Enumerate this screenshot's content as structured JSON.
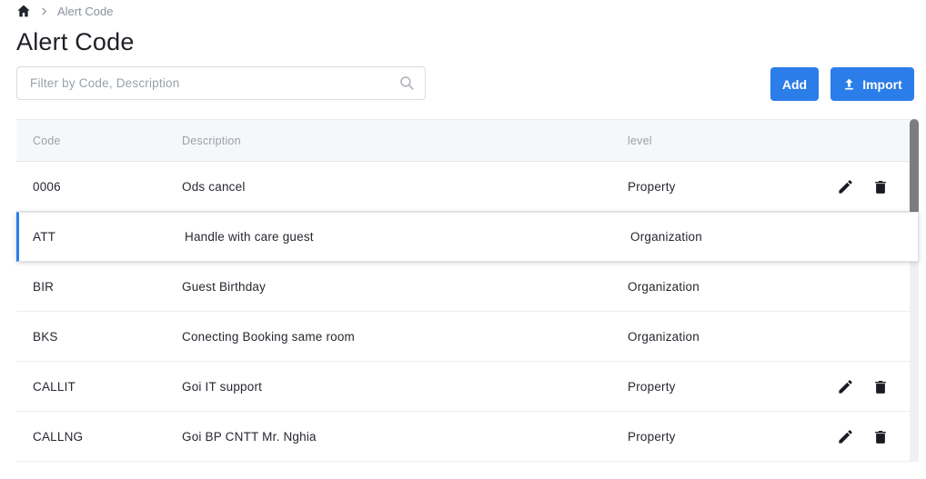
{
  "breadcrumb": {
    "current": "Alert Code"
  },
  "page": {
    "title": "Alert Code"
  },
  "toolbar": {
    "filter_placeholder": "Filter by Code, Description",
    "add_label": "Add",
    "import_label": "Import"
  },
  "colors": {
    "accent_blue": "#2b7de9",
    "icon_dark": "#191b23",
    "header_bg": "#f6f7f9",
    "header_text": "#9ba1ab",
    "row_text": "#26282f",
    "breadcrumb_text": "#8b919b",
    "scrollbar_thumb": "#7c7d81"
  },
  "table": {
    "columns": [
      "Code",
      "Description",
      "level"
    ],
    "rows": [
      {
        "code": "0006",
        "description": "Ods cancel",
        "level": "Property",
        "actions": true,
        "selected": false
      },
      {
        "code": "ATT",
        "description": "Handle with care guest",
        "level": "Organization",
        "actions": false,
        "selected": true
      },
      {
        "code": "BIR",
        "description": "Guest Birthday",
        "level": "Organization",
        "actions": false,
        "selected": false
      },
      {
        "code": "BKS",
        "description": "Conecting Booking same room",
        "level": "Organization",
        "actions": false,
        "selected": false
      },
      {
        "code": "CALLIT",
        "description": "Goi IT support",
        "level": "Property",
        "actions": true,
        "selected": false
      },
      {
        "code": "CALLNG",
        "description": "Goi BP CNTT Mr. Nghia",
        "level": "Property",
        "actions": true,
        "selected": false
      }
    ]
  }
}
